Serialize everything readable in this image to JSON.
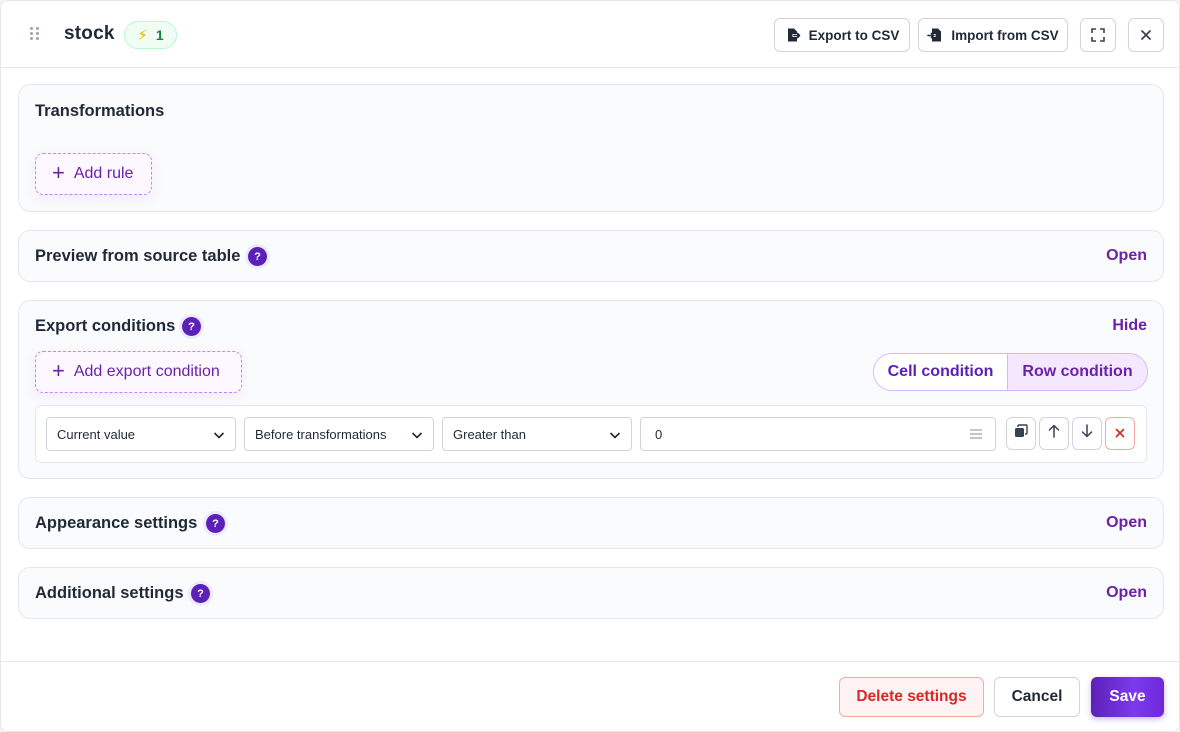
{
  "header": {
    "title": "stock",
    "badge_icon": "lightning-icon",
    "badge_count": "1",
    "export_csv_label": "Export to CSV",
    "import_csv_label": "Import from CSV",
    "fullscreen_icon": "expand-icon",
    "close_icon": "close-icon"
  },
  "transformations": {
    "title": "Transformations",
    "add_rule_label": "Add rule"
  },
  "preview": {
    "title": "Preview from source table",
    "help": "?",
    "toggle_label": "Open"
  },
  "export_conditions": {
    "title": "Export conditions",
    "help": "?",
    "toggle_label": "Hide",
    "add_condition_label": "Add export condition",
    "mode_tabs": [
      "Cell condition",
      "Row condition"
    ],
    "active_mode": "Row condition",
    "condition": {
      "source": "Current value",
      "stage": "Before transformations",
      "operator": "Greater than",
      "value": "0",
      "actions": [
        "duplicate-icon",
        "arrow-up-icon",
        "arrow-down-icon",
        "delete-x-icon"
      ]
    }
  },
  "appearance": {
    "title": "Appearance settings",
    "help": "?",
    "toggle_label": "Open"
  },
  "additional": {
    "title": "Additional settings",
    "help": "?",
    "toggle_label": "Open"
  },
  "footer": {
    "delete_label": "Delete settings",
    "cancel_label": "Cancel",
    "save_label": "Save"
  },
  "colors": {
    "accent": "#6b21a8",
    "save_button": "#5b21b6",
    "danger": "#dc2626",
    "badge": "#15803d"
  }
}
